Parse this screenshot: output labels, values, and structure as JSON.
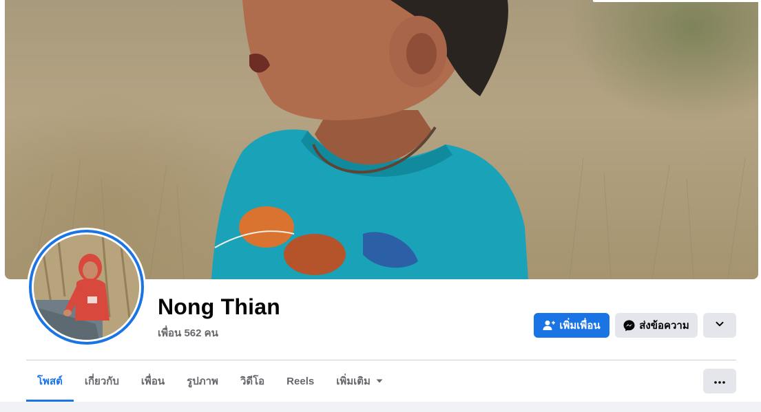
{
  "profile": {
    "name": "Nong Thian",
    "friend_count": "เพื่อน 562 คน"
  },
  "actions": {
    "add_friend_label": "เพิ่มเพื่อน",
    "message_label": "ส่งข้อความ"
  },
  "tabs": [
    {
      "label": "โพสต์",
      "active": true
    },
    {
      "label": "เกี่ยวกับ",
      "active": false
    },
    {
      "label": "เพื่อน",
      "active": false
    },
    {
      "label": "รูปภาพ",
      "active": false
    },
    {
      "label": "วิดีโอ",
      "active": false
    },
    {
      "label": "Reels",
      "active": false
    },
    {
      "label": "เพิ่มเติม",
      "active": false
    }
  ],
  "colors": {
    "accent": "#1b74e4",
    "secondary_button": "#e4e6eb",
    "muted_text": "#65676b"
  },
  "icons": {
    "add_friend": "person-plus-icon",
    "message": "messenger-icon",
    "dropdown": "chevron-down-icon",
    "more_tabs": "caret-down-icon",
    "overflow": "ellipsis-icon"
  }
}
